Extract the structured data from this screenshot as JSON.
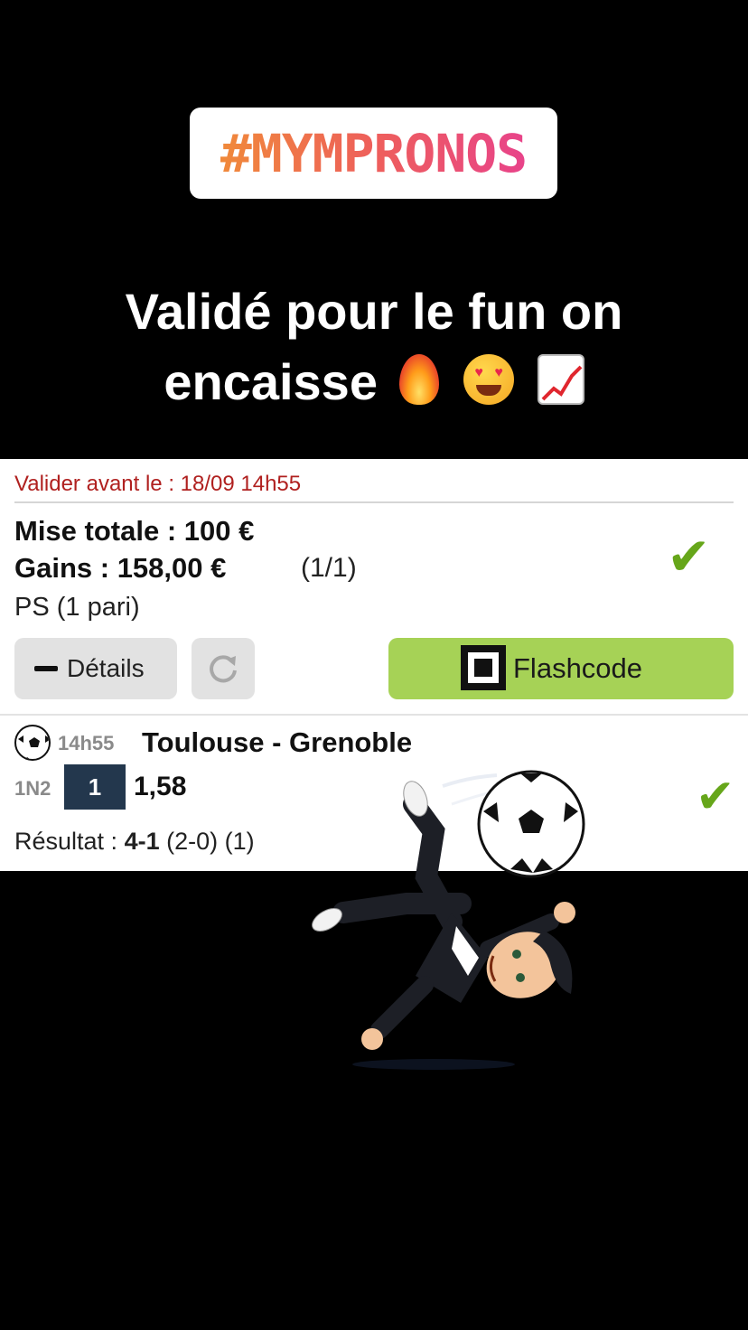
{
  "story": {
    "hashtag": "#MYMPRONOS",
    "caption_line1": "Validé pour le fun on",
    "caption_line2": "encaisse",
    "emojis": [
      "fire-icon",
      "heart-eyes-icon",
      "chart-increasing-icon"
    ]
  },
  "bet_slip": {
    "valid_before": "Valider avant le : 18/09 14h55",
    "stake": "Mise totale : 100 €",
    "gains": "Gains : 158,00 €",
    "gains_count": "(1/1)",
    "bet_type": "PS (1 pari)",
    "details_button": "Détails",
    "flashcode_button": "Flashcode",
    "colors": {
      "accent_green": "#a6d256",
      "check_green": "#66a61a",
      "deadline_red": "#b0201f",
      "pick_bg": "#23374d"
    }
  },
  "match": {
    "time": "14h55",
    "teams": "Toulouse - Grenoble",
    "bet_kind": "1N2",
    "pick": "1",
    "odds": "1,58",
    "result_label": "Résultat :",
    "result_score": "4-1",
    "result_detail": "(2-0) (1)"
  }
}
